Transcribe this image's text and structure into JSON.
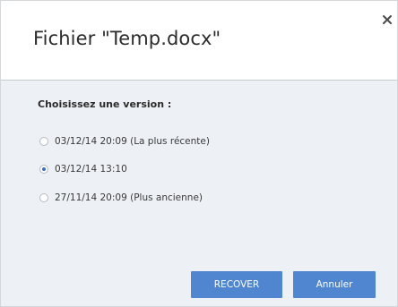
{
  "dialog": {
    "title": "Fichier \"Temp.docx\"",
    "close_icon": "close-icon",
    "prompt": "Choisissez une version :",
    "versions": [
      {
        "label": "03/12/14 20:09 (La plus récente)",
        "selected": false
      },
      {
        "label": "03/12/14 13:10",
        "selected": true
      },
      {
        "label": "27/11/14 20:09 (Plus ancienne)",
        "selected": false
      }
    ],
    "buttons": {
      "recover": "RECOVER",
      "cancel": "Annuler"
    }
  },
  "colors": {
    "accent": "#4f86cf",
    "radio_selected": "#3a70c4",
    "body_background": "#edf0f4"
  }
}
